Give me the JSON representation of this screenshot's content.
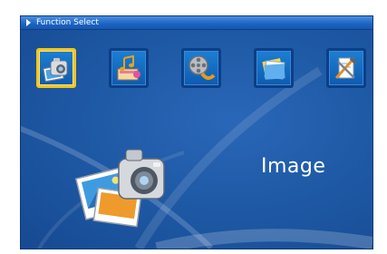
{
  "window": {
    "title": "Function Select"
  },
  "functions": [
    {
      "name": "image",
      "icon": "camera-photo-icon",
      "selected": true
    },
    {
      "name": "music",
      "icon": "music-icon",
      "selected": false
    },
    {
      "name": "movie",
      "icon": "film-reel-icon",
      "selected": false
    },
    {
      "name": "file",
      "icon": "folder-icon",
      "selected": false
    },
    {
      "name": "setup",
      "icon": "settings-tools-icon",
      "selected": false
    }
  ],
  "current_mode": {
    "label": "Image",
    "icon": "camera-photo-icon"
  },
  "colors": {
    "background": "#1f5aa6",
    "title_bar": "#1b63c4",
    "selection": "#f3c61c",
    "text": "#ffffff"
  }
}
